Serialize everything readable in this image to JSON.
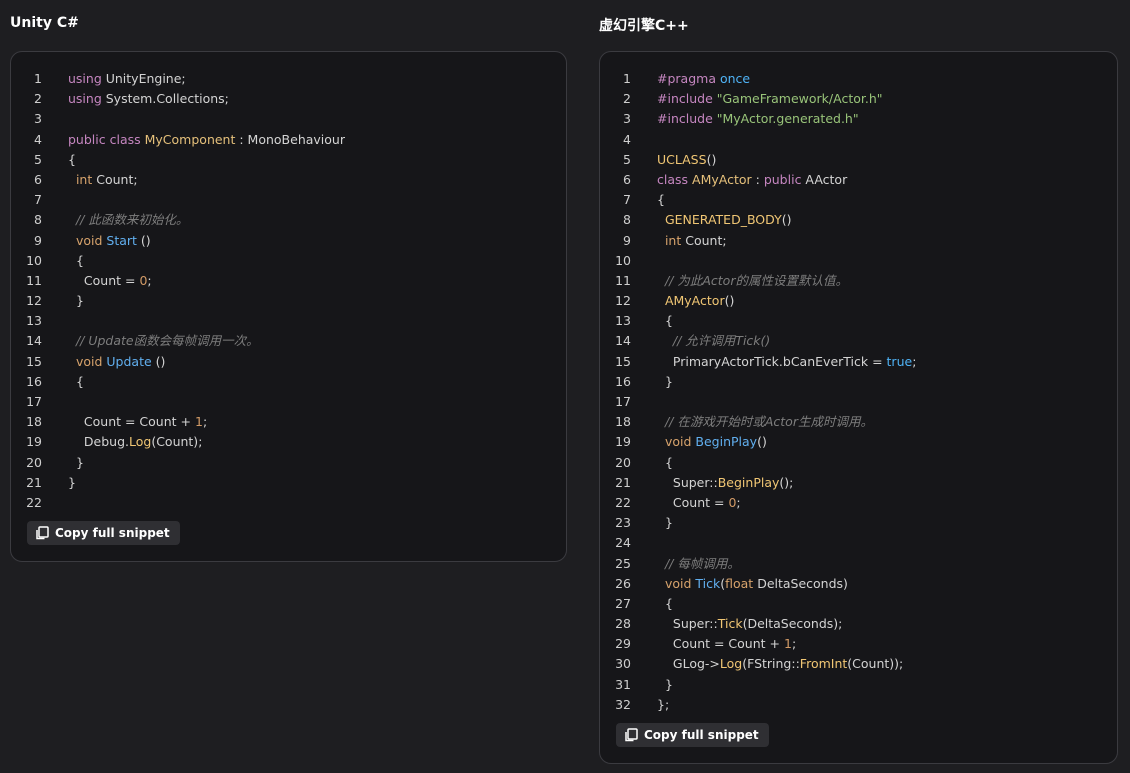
{
  "left": {
    "title": "Unity C#",
    "copy_label": "Copy full snippet",
    "lines": [
      [
        [
          "k",
          "using"
        ],
        [
          "p",
          " UnityEngine;"
        ]
      ],
      [
        [
          "k",
          "using"
        ],
        [
          "p",
          " System.Collections;"
        ]
      ],
      [],
      [
        [
          "k",
          "public"
        ],
        [
          "p",
          " "
        ],
        [
          "k",
          "class"
        ],
        [
          "p",
          " "
        ],
        [
          "t",
          "MyComponent"
        ],
        [
          "p",
          " : MonoBehaviour"
        ]
      ],
      [
        [
          "p",
          "{"
        ]
      ],
      [
        [
          "p",
          "  "
        ],
        [
          "kd",
          "int"
        ],
        [
          "p",
          " Count;"
        ]
      ],
      [],
      [
        [
          "p",
          "  "
        ],
        [
          "c",
          "// 此函数来初始化。"
        ]
      ],
      [
        [
          "p",
          "  "
        ],
        [
          "kd",
          "void"
        ],
        [
          "p",
          " "
        ],
        [
          "f",
          "Start"
        ],
        [
          "p",
          " ()"
        ]
      ],
      [
        [
          "p",
          "  {"
        ]
      ],
      [
        [
          "p",
          "    Count = "
        ],
        [
          "n",
          "0"
        ],
        [
          "p",
          ";"
        ]
      ],
      [
        [
          "p",
          "  }"
        ]
      ],
      [],
      [
        [
          "p",
          "  "
        ],
        [
          "c",
          "// Update函数会每帧调用一次。"
        ]
      ],
      [
        [
          "p",
          "  "
        ],
        [
          "kd",
          "void"
        ],
        [
          "p",
          " "
        ],
        [
          "f",
          "Update"
        ],
        [
          "p",
          " ()"
        ]
      ],
      [
        [
          "p",
          "  {"
        ]
      ],
      [],
      [
        [
          "p",
          "    Count = Count + "
        ],
        [
          "n",
          "1"
        ],
        [
          "p",
          ";"
        ]
      ],
      [
        [
          "p",
          "    Debug."
        ],
        [
          "m",
          "Log"
        ],
        [
          "p",
          "(Count);"
        ]
      ],
      [
        [
          "p",
          "  }"
        ]
      ],
      [
        [
          "p",
          "}"
        ]
      ],
      []
    ]
  },
  "right": {
    "title": "虚幻引擎C++",
    "copy_label": "Copy full snippet",
    "lines": [
      [
        [
          "k",
          "#pragma"
        ],
        [
          "p",
          " "
        ],
        [
          "b",
          "once"
        ]
      ],
      [
        [
          "k",
          "#include"
        ],
        [
          "p",
          " "
        ],
        [
          "s",
          "\"GameFramework/Actor.h\""
        ]
      ],
      [
        [
          "k",
          "#include"
        ],
        [
          "p",
          " "
        ],
        [
          "s",
          "\"MyActor.generated.h\""
        ]
      ],
      [],
      [
        [
          "m",
          "UCLASS"
        ],
        [
          "p",
          "()"
        ]
      ],
      [
        [
          "k",
          "class"
        ],
        [
          "p",
          " "
        ],
        [
          "t",
          "AMyActor"
        ],
        [
          "p",
          " : "
        ],
        [
          "k",
          "public"
        ],
        [
          "p",
          " AActor"
        ]
      ],
      [
        [
          "p",
          "{"
        ]
      ],
      [
        [
          "p",
          "  "
        ],
        [
          "m",
          "GENERATED_BODY"
        ],
        [
          "p",
          "()"
        ]
      ],
      [
        [
          "p",
          "  "
        ],
        [
          "kd",
          "int"
        ],
        [
          "p",
          " Count;"
        ]
      ],
      [],
      [
        [
          "p",
          "  "
        ],
        [
          "c",
          "// 为此Actor的属性设置默认值。"
        ]
      ],
      [
        [
          "p",
          "  "
        ],
        [
          "m",
          "AMyActor"
        ],
        [
          "p",
          "()"
        ]
      ],
      [
        [
          "p",
          "  {"
        ]
      ],
      [
        [
          "p",
          "    "
        ],
        [
          "c",
          "// 允许调用Tick()"
        ]
      ],
      [
        [
          "p",
          "    PrimaryActorTick.bCanEverTick = "
        ],
        [
          "b",
          "true"
        ],
        [
          "p",
          ";"
        ]
      ],
      [
        [
          "p",
          "  }"
        ]
      ],
      [],
      [
        [
          "p",
          "  "
        ],
        [
          "c",
          "// 在游戏开始时或Actor生成时调用。"
        ]
      ],
      [
        [
          "p",
          "  "
        ],
        [
          "kd",
          "void"
        ],
        [
          "p",
          " "
        ],
        [
          "f",
          "BeginPlay"
        ],
        [
          "p",
          "()"
        ]
      ],
      [
        [
          "p",
          "  {"
        ]
      ],
      [
        [
          "p",
          "    Super::"
        ],
        [
          "m",
          "BeginPlay"
        ],
        [
          "p",
          "();"
        ]
      ],
      [
        [
          "p",
          "    Count = "
        ],
        [
          "n",
          "0"
        ],
        [
          "p",
          ";"
        ]
      ],
      [
        [
          "p",
          "  }"
        ]
      ],
      [],
      [
        [
          "p",
          "  "
        ],
        [
          "c",
          "// 每帧调用。"
        ]
      ],
      [
        [
          "p",
          "  "
        ],
        [
          "kd",
          "void"
        ],
        [
          "p",
          " "
        ],
        [
          "f",
          "Tick"
        ],
        [
          "p",
          "("
        ],
        [
          "kd",
          "float"
        ],
        [
          "p",
          " DeltaSeconds)"
        ]
      ],
      [
        [
          "p",
          "  {"
        ]
      ],
      [
        [
          "p",
          "    Super::"
        ],
        [
          "m",
          "Tick"
        ],
        [
          "p",
          "(DeltaSeconds);"
        ]
      ],
      [
        [
          "p",
          "    Count = Count + "
        ],
        [
          "n",
          "1"
        ],
        [
          "p",
          ";"
        ]
      ],
      [
        [
          "p",
          "    GLog->"
        ],
        [
          "m",
          "Log"
        ],
        [
          "p",
          "(FString::"
        ],
        [
          "m",
          "FromInt"
        ],
        [
          "p",
          "(Count));"
        ]
      ],
      [
        [
          "p",
          "  }"
        ]
      ],
      [
        [
          "p",
          "};"
        ]
      ]
    ]
  }
}
